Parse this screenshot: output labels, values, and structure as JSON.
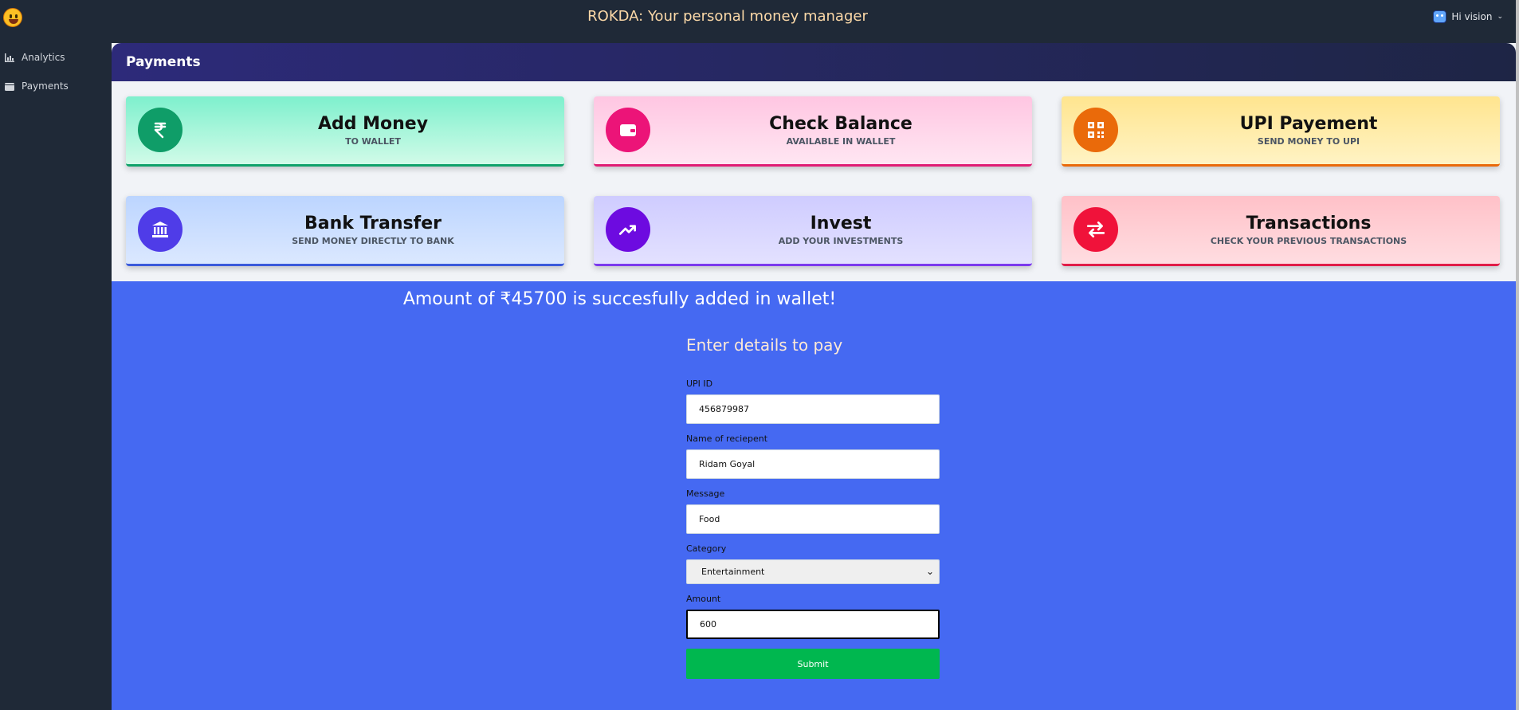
{
  "app": {
    "title": "ROKDA: Your personal money manager",
    "user_greeting": "Hi vision"
  },
  "sidebar": {
    "items": [
      {
        "label": "Analytics",
        "icon": "chart-icon"
      },
      {
        "label": "Payments",
        "icon": "wallet-icon"
      }
    ]
  },
  "main": {
    "title": "Payments"
  },
  "cards": [
    {
      "title": "Add Money",
      "subtitle": "TO WALLET",
      "icon": "rupee-icon",
      "color": "#0f9d68"
    },
    {
      "title": "Check Balance",
      "subtitle": "AVAILABLE IN WALLET",
      "icon": "wallet-icon",
      "color": "#ec1478"
    },
    {
      "title": "UPI Payement",
      "subtitle": "SEND MONEY TO UPI",
      "icon": "qr-code-icon",
      "color": "#ea6a0a"
    },
    {
      "title": "Bank Transfer",
      "subtitle": "SEND MONEY DIRECTLY TO BANK",
      "icon": "bank-icon",
      "color": "#4f3ce8"
    },
    {
      "title": "Invest",
      "subtitle": "ADD YOUR INVESTMENTS",
      "icon": "trending-up-icon",
      "color": "#6d0be0"
    },
    {
      "title": "Transactions",
      "subtitle": "CHECK YOUR PREVIOUS TRANSACTIONS",
      "icon": "swap-arrows-icon",
      "color": "#f0123a"
    }
  ],
  "notice": {
    "message": "Amount of ₹45700 is succesfully added in wallet!"
  },
  "form": {
    "title": "Enter details to pay",
    "upi_label": "UPI ID",
    "upi_value": "456879987",
    "name_label": "Name of reciepent",
    "name_value": "Ridam Goyal",
    "message_label": "Message",
    "message_value": "Food",
    "category_label": "Category",
    "category_value": "Entertainment",
    "amount_label": "Amount",
    "amount_value": "600",
    "submit_label": "Submit"
  }
}
